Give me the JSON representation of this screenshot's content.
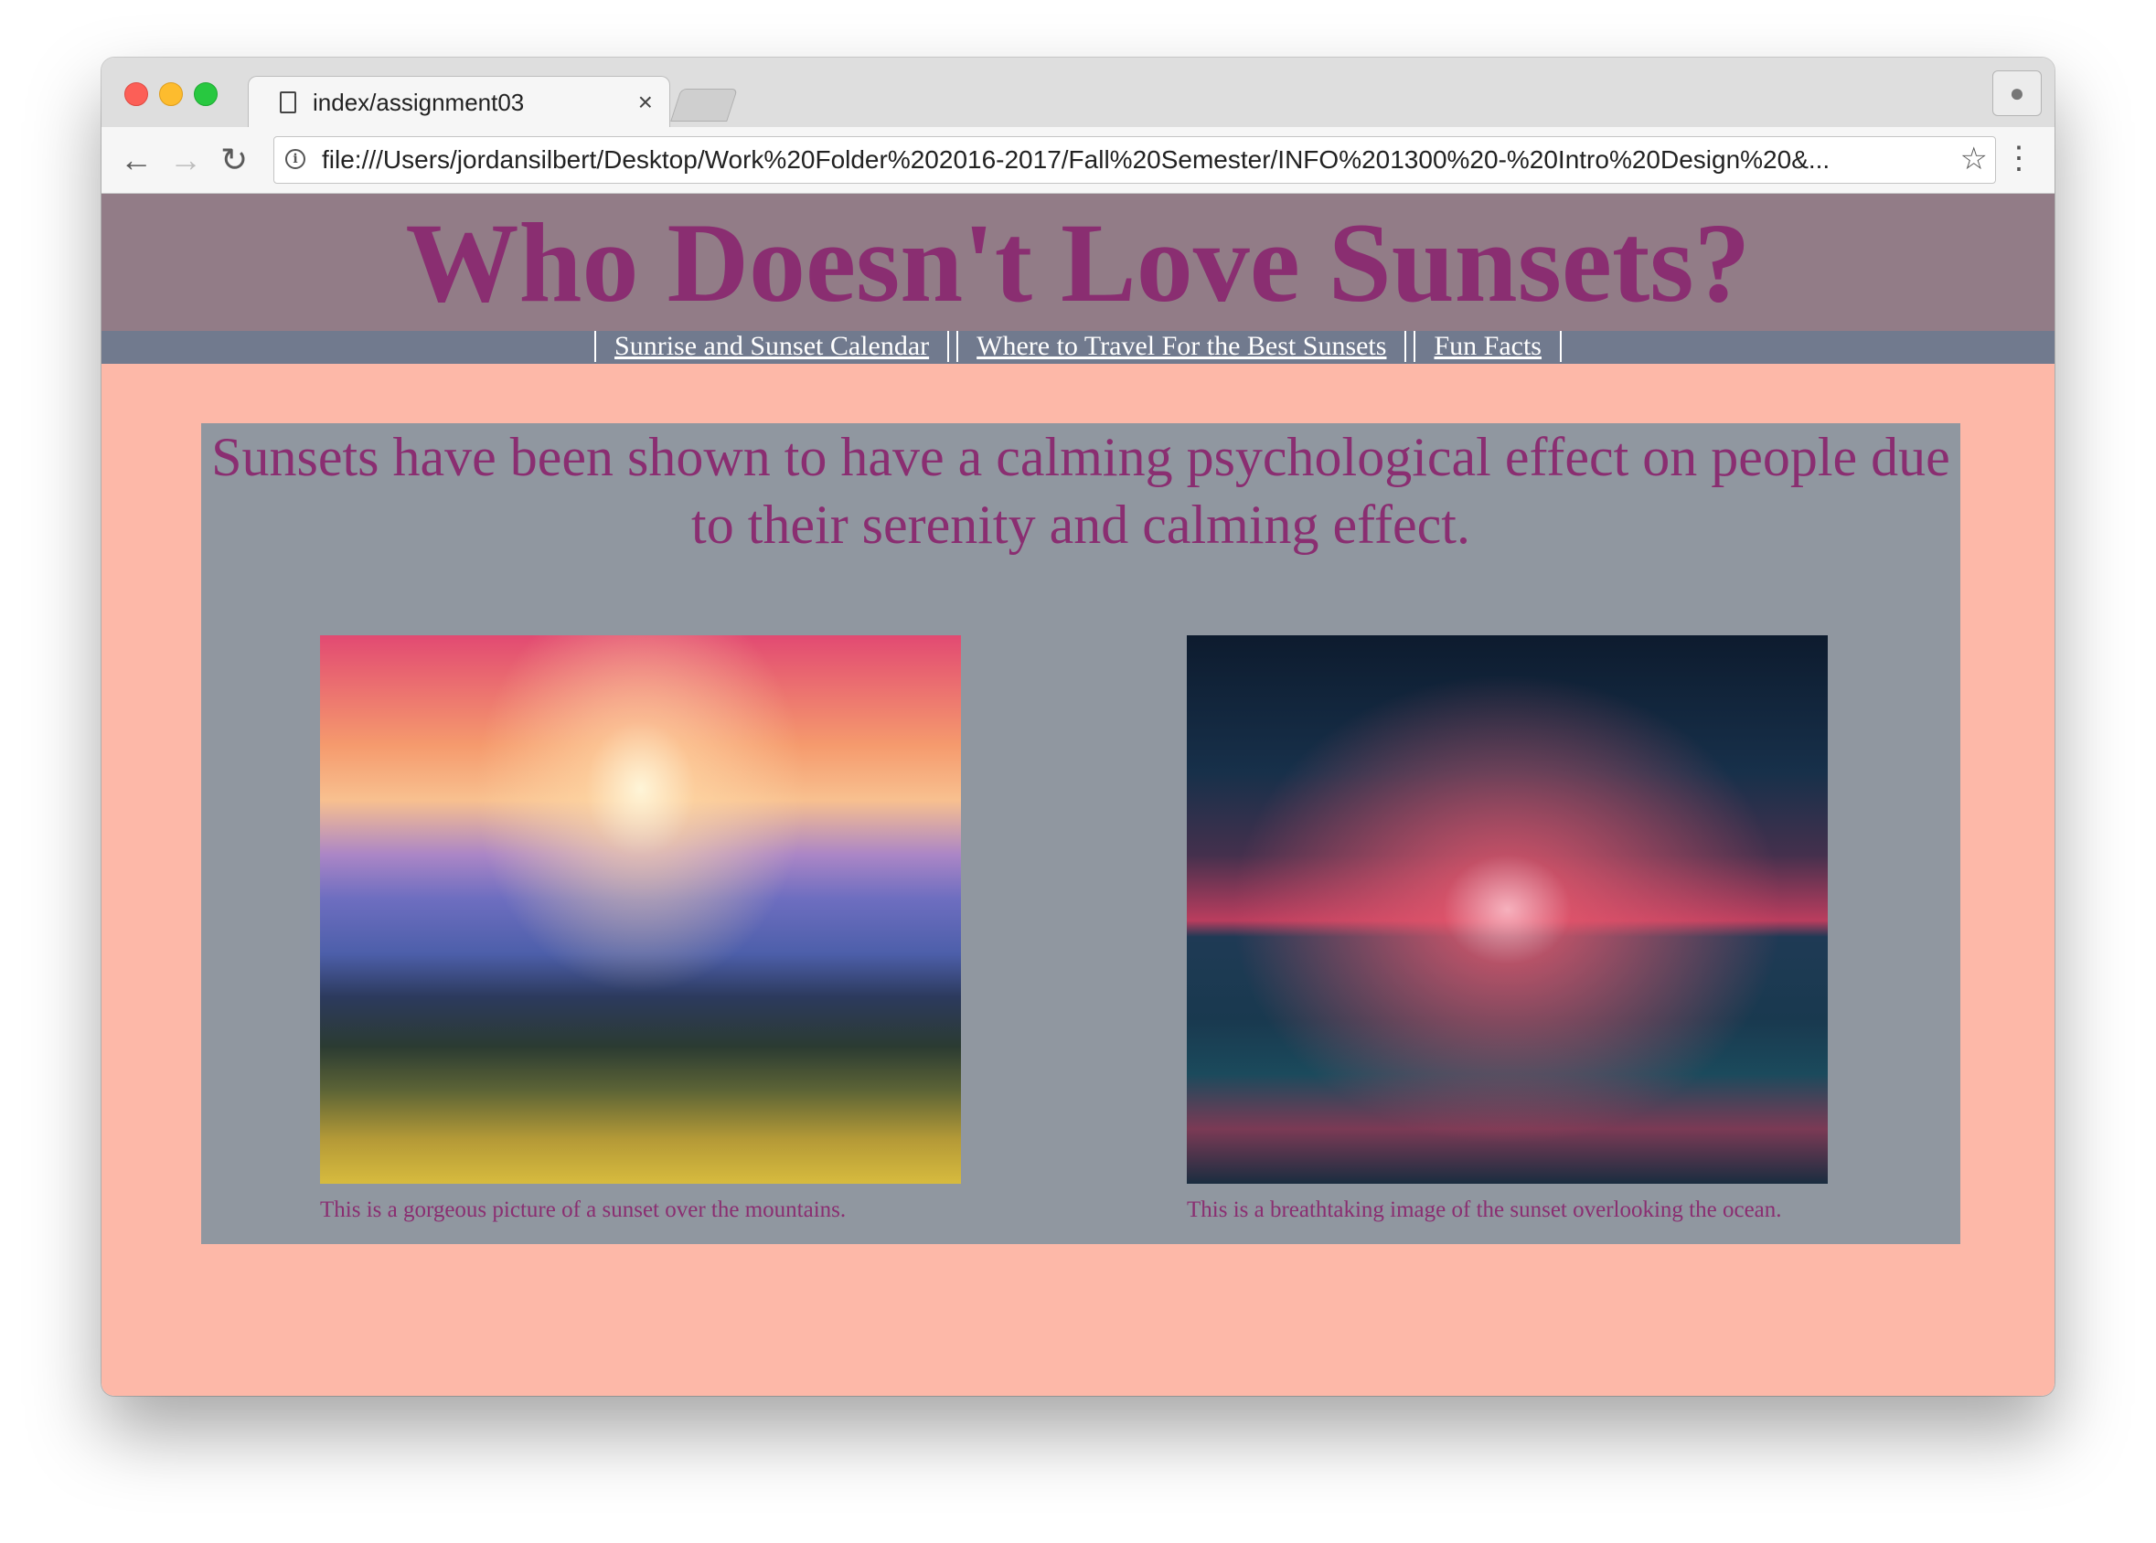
{
  "browser": {
    "tab_title": "index/assignment03",
    "tab_close": "×",
    "url": "file:///Users/jordansilbert/Desktop/Work%20Folder%202016-2017/Fall%20Semester/INFO%201300%20-%20Intro%20Design%20&..."
  },
  "header": {
    "title": "Who Doesn't Love Sunsets?"
  },
  "nav": {
    "items": [
      {
        "label": "Sunrise and Sunset Calendar"
      },
      {
        "label": "Where to Travel For the Best Sunsets"
      },
      {
        "label": "Fun Facts"
      }
    ]
  },
  "main": {
    "lead": "Sunsets have been shown to have a calming psychological effect on people due to their serenity and calming effect.",
    "photos": [
      {
        "caption": "This is a gorgeous picture of a sunset over the mountains."
      },
      {
        "caption": "This is a breathtaking image of the sunset overlooking the ocean."
      }
    ]
  },
  "colors": {
    "page_background": "#fdb8a8",
    "header_background": "#927c87",
    "nav_background": "#717a8e",
    "content_background": "#9097a0",
    "accent_text": "#8a2e71"
  }
}
